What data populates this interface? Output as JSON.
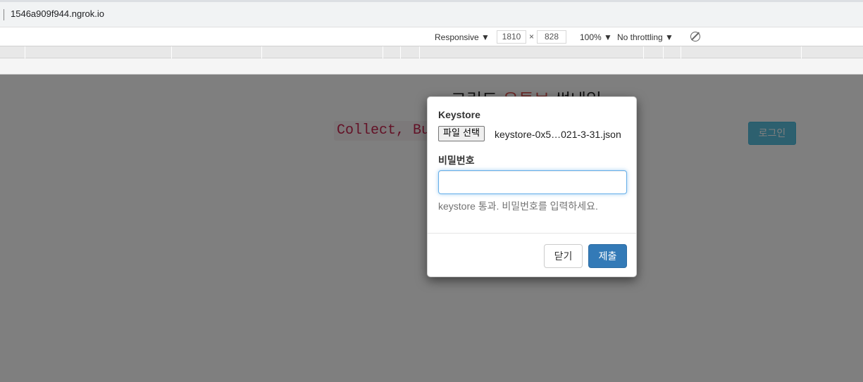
{
  "browser": {
    "url": "1546a909f944.ngrok.io"
  },
  "devtools": {
    "device": "Responsive ▼",
    "width": "1810",
    "times": "×",
    "height": "828",
    "zoom": "100% ▼",
    "throttling": "No throttling ▼",
    "rotate_icon": "rotate-icon"
  },
  "page": {
    "title_pre": "그린드 ",
    "title_red": "유튜브",
    "title_post": " 썸네일",
    "tagline": "Collect, Buy and Sell Thumbnails!",
    "login_label": "로그인"
  },
  "modal": {
    "keystore_label": "Keystore",
    "file_button": "파일 선택",
    "file_name": "keystore-0x5…021-3-31.json",
    "password_label": "비밀번호",
    "password_value": "",
    "help_text": "keystore 통과. 비밀번호를 입력하세요.",
    "close_label": "닫기",
    "submit_label": "제출"
  },
  "colors": {
    "primary": "#337ab7",
    "info": "#5bc0de",
    "code_red": "#c7254e",
    "backdrop": "#808080"
  }
}
